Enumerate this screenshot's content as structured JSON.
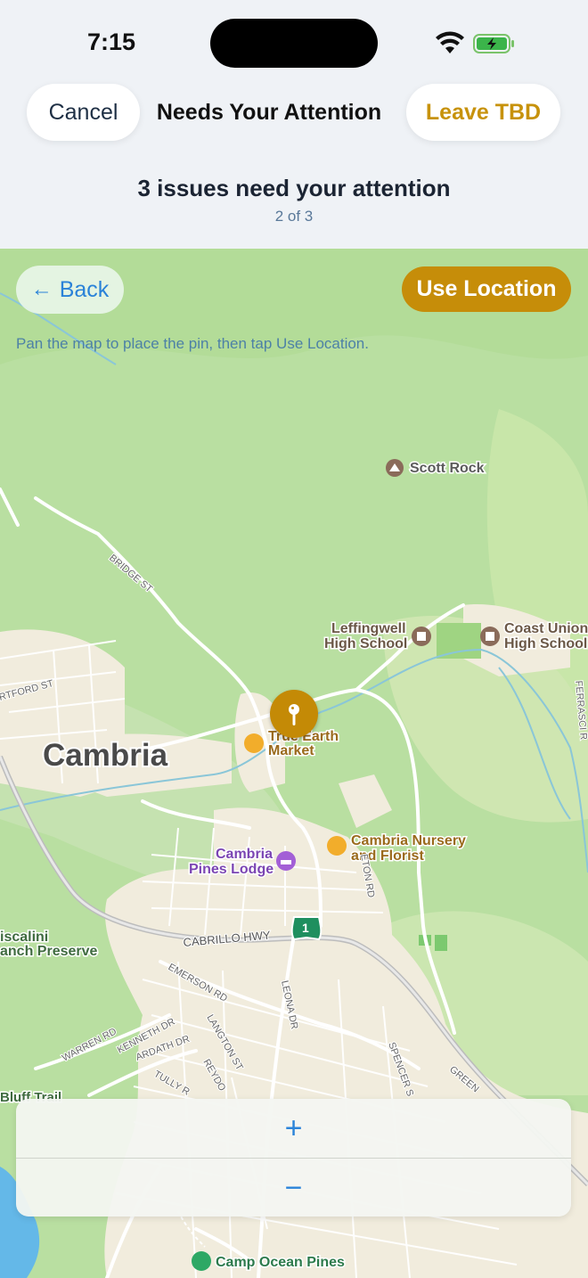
{
  "status": {
    "time": "7:15"
  },
  "nav": {
    "cancel_label": "Cancel",
    "title": "Needs Your Attention",
    "leave_label": "Leave TBD"
  },
  "header": {
    "issues": "3 issues need your attention",
    "count": "2 of 3"
  },
  "map": {
    "back_label": "Back",
    "use_location_label": "Use Location",
    "hint": "Pan the map to place the pin, then tap Use Location.",
    "labels": {
      "town": "Cambria",
      "scott_rock": "Scott Rock",
      "leffingwell_1": "Leffingwell",
      "leffingwell_2": "High School",
      "coast_union_1": "Coast Union",
      "coast_union_2": "High School",
      "true_earth_1": "True Earth",
      "true_earth_2": "Market",
      "nursery_1": "Cambria Nursery",
      "nursery_2": "and Florist",
      "lodge_1": "Cambria",
      "lodge_2": "Pines Lodge",
      "preserve_1": "iscalini",
      "preserve_2": "anch Preserve",
      "camp": "Camp Ocean Pines",
      "bluff": "Bluff Trail",
      "hwy_shield": "1",
      "streets": {
        "bridge": "BRIDGE ST",
        "cabrillo": "CABRILLO HWY",
        "eton": "ETON RD",
        "emerson": "EMERSON RD",
        "leona": "LEONA DR",
        "warren": "WARREN RD",
        "kenneth": "KENNETH DR",
        "ardath": "ARDATH DR",
        "langton": "LANGTON ST",
        "tully": "TULLY R",
        "reydo": "REYDO",
        "spencer": "SPENCER S",
        "green": "GREEN",
        "rtford": "RTFORD ST",
        "ferrasci": "FERRASCI R"
      }
    },
    "zoom_in": "+",
    "zoom_out": "−"
  }
}
